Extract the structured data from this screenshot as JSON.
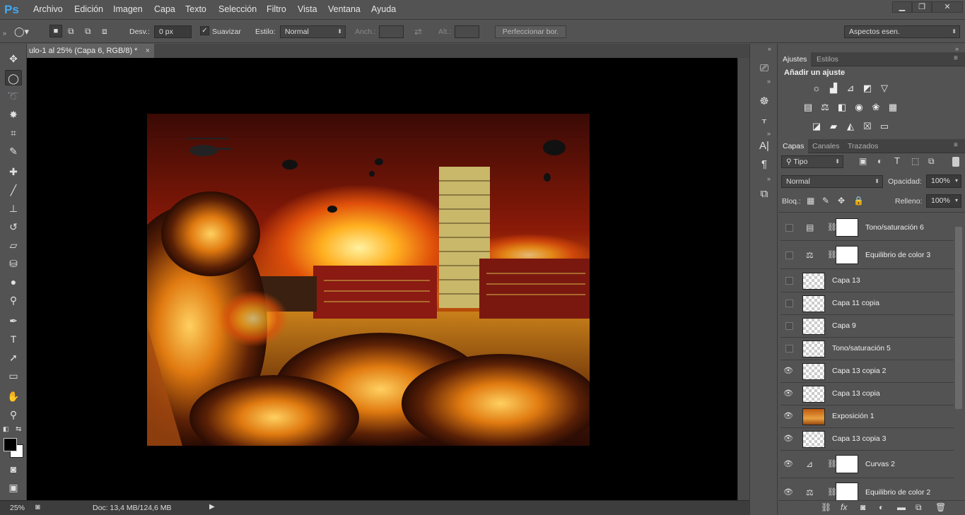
{
  "app": {
    "logo": "Ps"
  },
  "menu": [
    "Archivo",
    "Edición",
    "Imagen",
    "Capa",
    "Texto",
    "Selección",
    "Filtro",
    "Vista",
    "Ventana",
    "Ayuda"
  ],
  "window_controls": {
    "minimize": "▁",
    "maximize": "❐",
    "close": "✕"
  },
  "options": {
    "feather_label": "Desv.:",
    "feather_value": "0 px",
    "antialias_label": "Suavizar",
    "style_label": "Estilo:",
    "style_value": "Normal",
    "width_label": "Anch.:",
    "height_label": "Alt.:",
    "refine_button": "Perfeccionar bor.",
    "workspace": "Aspectos esen."
  },
  "document": {
    "tab_title": "ulo-1 al 25% (Capa 6, RGB/8) *",
    "close": "×",
    "zoom": "25%",
    "doc_info": "Doc: 13,4 MB/124,6 MB"
  },
  "adjustments": {
    "tabs": [
      "Ajustes",
      "Estilos"
    ],
    "heading": "Añadir un ajuste",
    "icons": [
      "brightness-icon",
      "levels-icon",
      "curves-icon",
      "exposure-icon",
      "vibrance-icon",
      "hue-saturation-icon",
      "color-balance-icon",
      "black-white-icon",
      "photo-filter-icon",
      "channel-mixer-icon",
      "color-lookup-icon",
      "invert-icon",
      "posterize-icon",
      "threshold-icon",
      "selective-color-icon",
      "gradient-map-icon"
    ]
  },
  "layers": {
    "tabs": [
      "Capas",
      "Canales",
      "Trazados"
    ],
    "filter_value": "Tipo",
    "blend_mode": "Normal",
    "opacity_label": "Opacidad:",
    "opacity_value": "100%",
    "lock_label": "Bloq.:",
    "fill_label": "Relleno:",
    "fill_value": "100%",
    "items": [
      {
        "name": "Tono/saturación 6",
        "visible": false,
        "type": "adjustment",
        "icon": "hue-saturation-icon"
      },
      {
        "name": "Equilibrio de color 3",
        "visible": false,
        "type": "adjustment",
        "icon": "color-balance-icon"
      },
      {
        "name": "Capa 13",
        "visible": false,
        "type": "pixel"
      },
      {
        "name": "Capa 11 copia",
        "visible": false,
        "type": "pixel"
      },
      {
        "name": "Capa 9",
        "visible": false,
        "type": "pixel"
      },
      {
        "name": "Tono/saturación 5",
        "visible": false,
        "type": "pixel"
      },
      {
        "name": "Capa 13 copia 2",
        "visible": true,
        "type": "pixel"
      },
      {
        "name": "Capa 13 copia",
        "visible": true,
        "type": "pixel"
      },
      {
        "name": "Exposición 1",
        "visible": true,
        "type": "pixel"
      },
      {
        "name": "Capa 13 copia 3",
        "visible": true,
        "type": "pixel"
      },
      {
        "name": "Curvas 2",
        "visible": true,
        "type": "adjustment",
        "icon": "curves-icon"
      },
      {
        "name": "Equilibrio de color 2",
        "visible": true,
        "type": "adjustment",
        "icon": "color-balance-icon"
      }
    ]
  },
  "colors": {
    "ui_bg": "#535353",
    "panel_dark": "#424242",
    "ps_blue": "#3fa9f5",
    "canvas_bg": "#000000"
  }
}
